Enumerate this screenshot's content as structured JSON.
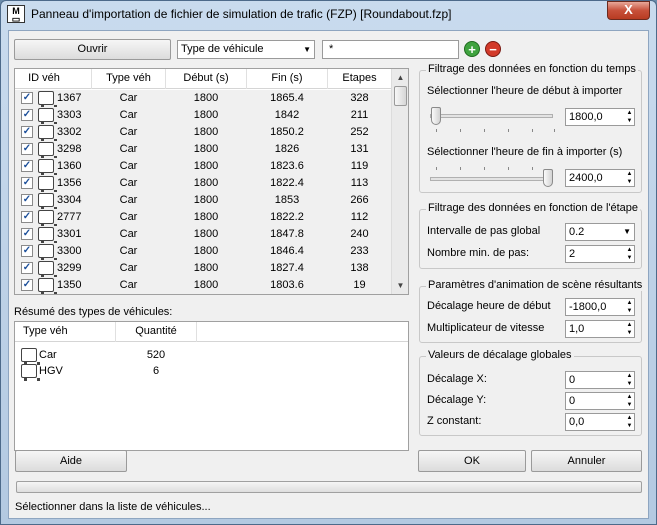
{
  "window": {
    "title": "Panneau d'importation de fichier de simulation de trafic (FZP) [Roundabout.fzp]",
    "app_icon_text": "M",
    "close_label": "X"
  },
  "toolbar": {
    "open_label": "Ouvrir",
    "filter_select_value": "Type de véhicule",
    "filter_value": "*",
    "add_icon": "plus-icon",
    "remove_icon": "minus-icon"
  },
  "vehicle_table": {
    "columns": [
      "ID véh",
      "Type véh",
      "Début (s)",
      "Fin (s)",
      "Etapes"
    ],
    "rows": [
      {
        "id": "1367",
        "type": "Car",
        "start": "1800",
        "end": "1865.4",
        "steps": "328"
      },
      {
        "id": "3303",
        "type": "Car",
        "start": "1800",
        "end": "1842",
        "steps": "211"
      },
      {
        "id": "3302",
        "type": "Car",
        "start": "1800",
        "end": "1850.2",
        "steps": "252"
      },
      {
        "id": "3298",
        "type": "Car",
        "start": "1800",
        "end": "1826",
        "steps": "131"
      },
      {
        "id": "1360",
        "type": "Car",
        "start": "1800",
        "end": "1823.6",
        "steps": "119"
      },
      {
        "id": "1356",
        "type": "Car",
        "start": "1800",
        "end": "1822.4",
        "steps": "113"
      },
      {
        "id": "3304",
        "type": "Car",
        "start": "1800",
        "end": "1853",
        "steps": "266"
      },
      {
        "id": "2777",
        "type": "Car",
        "start": "1800",
        "end": "1822.2",
        "steps": "112"
      },
      {
        "id": "3301",
        "type": "Car",
        "start": "1800",
        "end": "1847.8",
        "steps": "240"
      },
      {
        "id": "3300",
        "type": "Car",
        "start": "1800",
        "end": "1846.4",
        "steps": "233"
      },
      {
        "id": "3299",
        "type": "Car",
        "start": "1800",
        "end": "1827.4",
        "steps": "138"
      },
      {
        "id": "1350",
        "type": "Car",
        "start": "1800",
        "end": "1803.6",
        "steps": "19"
      }
    ]
  },
  "summary": {
    "title": "Résumé des types de véhicules:",
    "columns": [
      "Type véh",
      "Quantité"
    ],
    "rows": [
      {
        "type": "Car",
        "qty": "520"
      },
      {
        "type": "HGV",
        "qty": "6"
      }
    ]
  },
  "time_filter": {
    "title": "Filtrage des données en fonction du temps",
    "start_label": "Sélectionner l'heure de début à importer",
    "start_value": "1800,0",
    "end_label": "Sélectionner l'heure de fin à importer (s)",
    "end_value": "2400,0"
  },
  "step_filter": {
    "title": "Filtrage des données en fonction de l'étape",
    "interval_label": "Intervalle de pas global",
    "interval_value": "0.2",
    "min_steps_label": "Nombre min. de pas:",
    "min_steps_value": "2"
  },
  "animation": {
    "title": "Paramètres d'animation de scène résultants",
    "offset_label": "Décalage heure de début",
    "offset_value": "-1800,0",
    "speed_label": "Multiplicateur de vitesse",
    "speed_value": "1,0"
  },
  "offsets": {
    "title": "Valeurs de décalage globales",
    "x_label": "Décalage X:",
    "x_value": "0",
    "y_label": "Décalage Y:",
    "y_value": "0",
    "z_label": "Z constant:",
    "z_value": "0,0"
  },
  "buttons": {
    "help": "Aide",
    "ok": "OK",
    "cancel": "Annuler"
  },
  "status": {
    "text": "Sélectionner dans la liste de véhicules..."
  }
}
